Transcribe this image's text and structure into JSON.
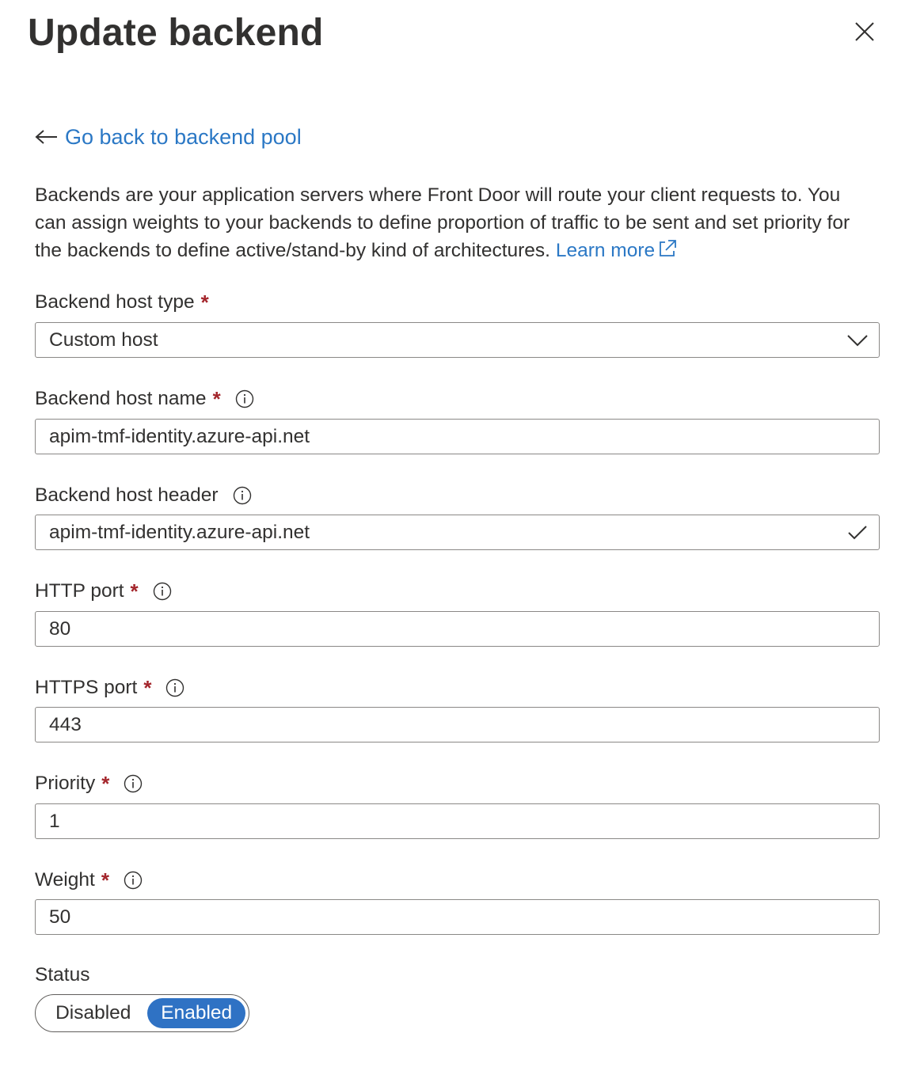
{
  "panel": {
    "title": "Update backend"
  },
  "back_link": {
    "label": "Go back to backend pool"
  },
  "description": {
    "text": "Backends are your application servers where Front Door will route your client requests to. You can assign weights to your backends to define proportion of traffic to be sent and set priority for the backends to define active/stand-by kind of architectures.",
    "learn_more": "Learn more"
  },
  "fields": {
    "host_type": {
      "label": "Backend host type",
      "required_mark": "*",
      "value": "Custom host"
    },
    "host_name": {
      "label": "Backend host name",
      "required_mark": "*",
      "value": "apim-tmf-identity.azure-api.net"
    },
    "host_header": {
      "label": "Backend host header",
      "value": "apim-tmf-identity.azure-api.net"
    },
    "http_port": {
      "label": "HTTP port",
      "required_mark": "*",
      "value": "80"
    },
    "https_port": {
      "label": "HTTPS port",
      "required_mark": "*",
      "value": "443"
    },
    "priority": {
      "label": "Priority",
      "required_mark": "*",
      "value": "1"
    },
    "weight": {
      "label": "Weight",
      "required_mark": "*",
      "value": "50"
    }
  },
  "status": {
    "label": "Status",
    "options": [
      "Disabled",
      "Enabled"
    ],
    "selected": "Enabled"
  },
  "icons": {
    "close": "close-icon",
    "back": "arrow-left-icon",
    "external": "external-link-icon",
    "info": "info-icon",
    "dropdown": "chevron-down-icon",
    "valid": "checkmark-icon"
  },
  "colors": {
    "link": "#2b78c5",
    "required": "#a4262c",
    "toggle_on": "#2f72c4",
    "text": "#323130",
    "border": "#8a8886"
  }
}
